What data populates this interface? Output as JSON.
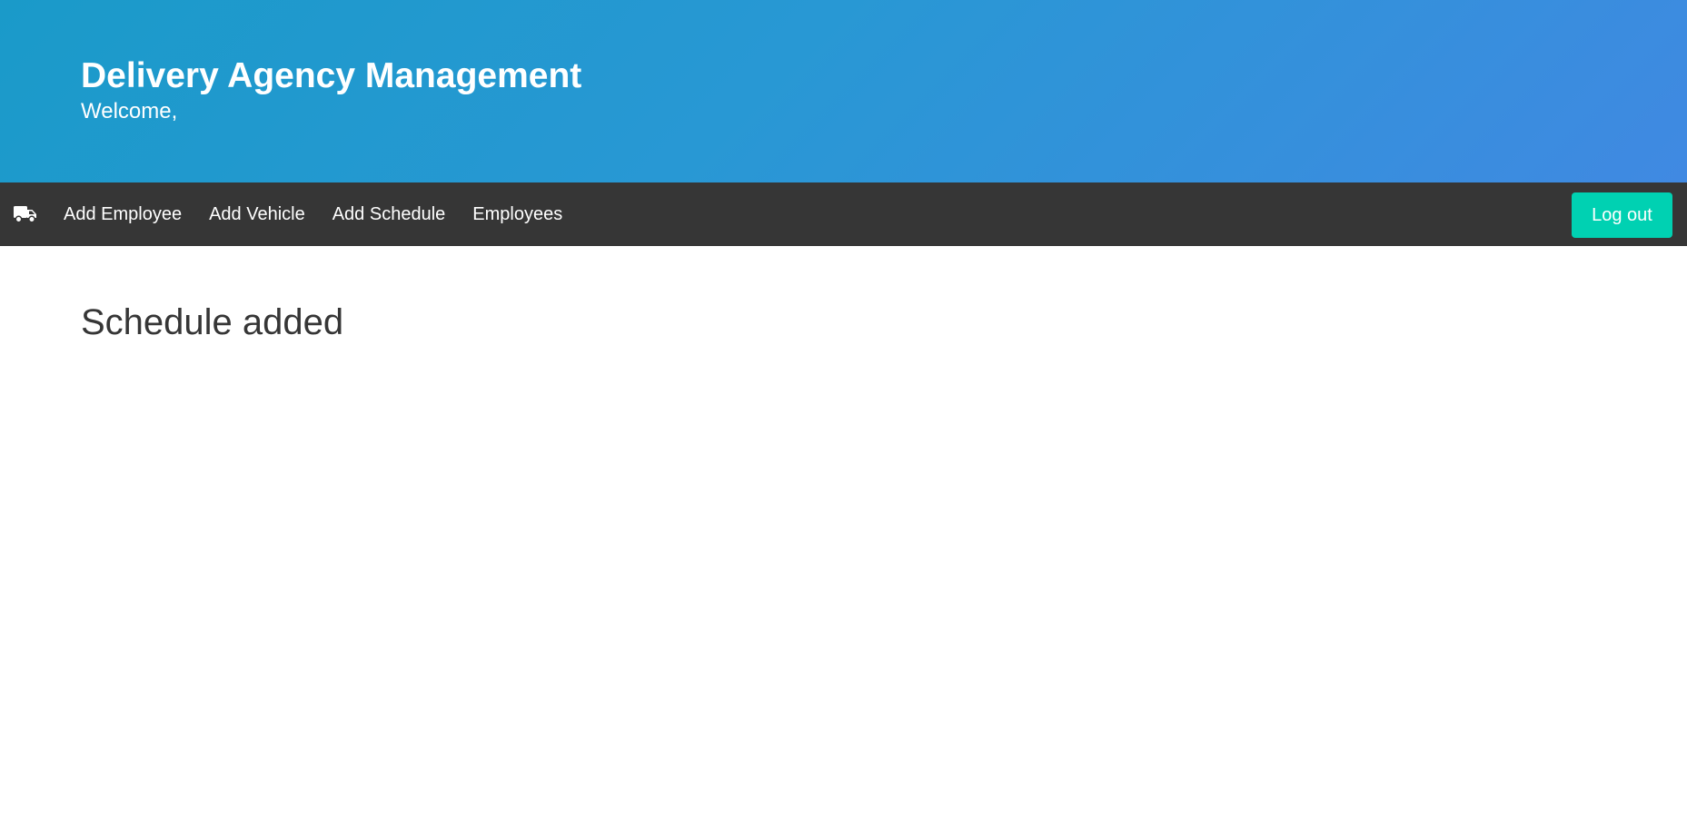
{
  "header": {
    "title": "Delivery Agency Management",
    "subtitle": "Welcome,"
  },
  "navbar": {
    "brand_icon": "truck-icon",
    "items": [
      {
        "label": "Add Employee"
      },
      {
        "label": "Add Vehicle"
      },
      {
        "label": "Add Schedule"
      },
      {
        "label": "Employees"
      }
    ],
    "logout_label": "Log out"
  },
  "main": {
    "title": "Schedule added"
  },
  "colors": {
    "hero_start": "#1a9ac9",
    "hero_end": "#4089e2",
    "navbar_bg": "#363636",
    "logout_bg": "#00d1b2",
    "text_dark": "#363636"
  }
}
